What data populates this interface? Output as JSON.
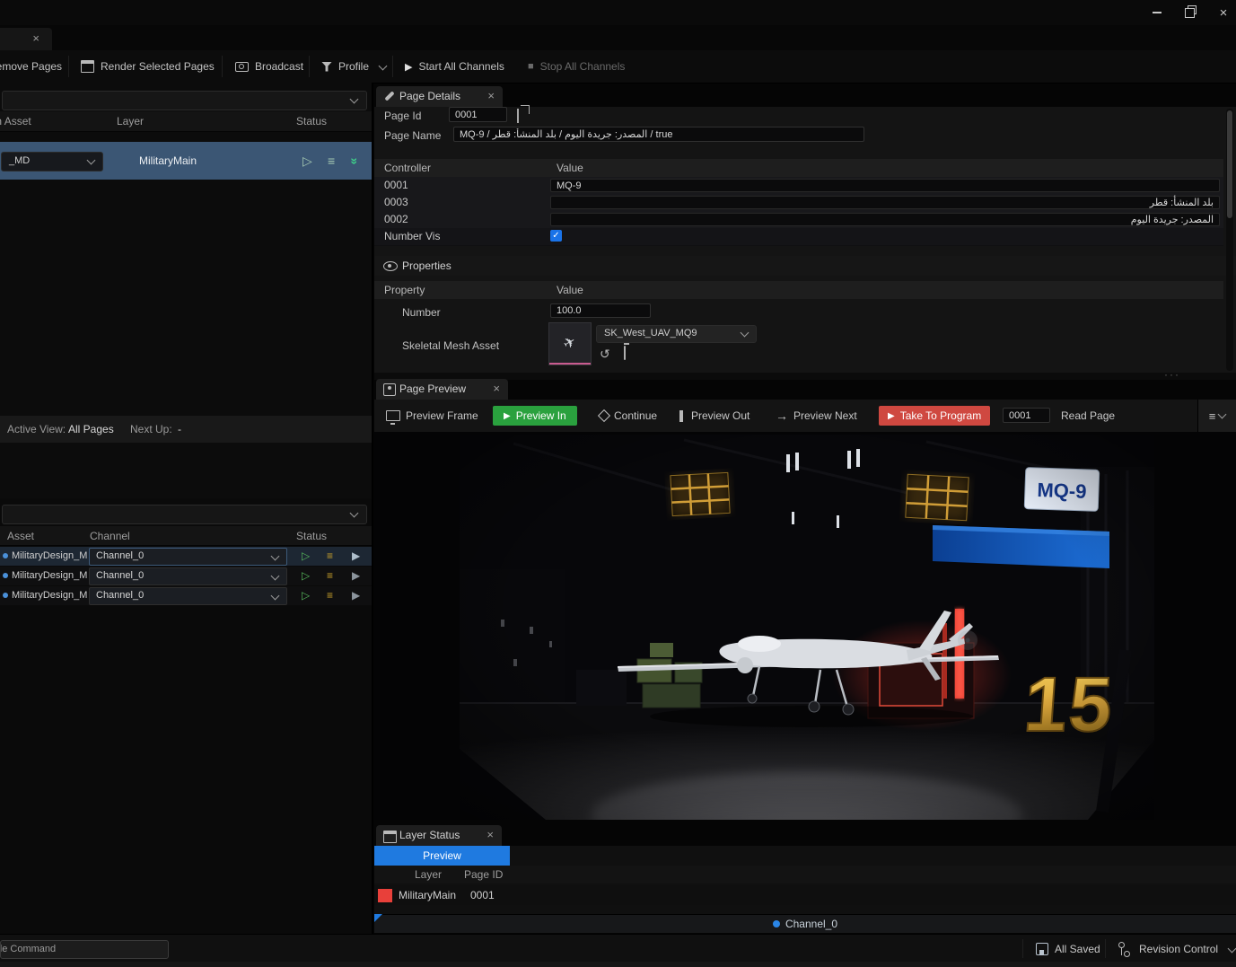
{
  "icons": {
    "close": "×",
    "play_filled": "▶",
    "play_outline": "▷",
    "menu": "≡",
    "double_chevron": "»",
    "stop": "■",
    "arrow_right": "→",
    "check": "✓",
    "dots": "···",
    "undo": "↺",
    "diamond": "◇",
    "plane": "✈"
  },
  "toolbar": {
    "remove_pages": "Remove Pages",
    "render_selected_pages": "Render Selected Pages",
    "broadcast": "Broadcast",
    "profile": "Profile",
    "start_all_channels": "Start All Channels",
    "stop_all_channels": "Stop All Channels"
  },
  "pages_panel": {
    "columns": {
      "asset": "Motion Asset",
      "layer": "Layer",
      "status": "Status"
    },
    "selected_row": {
      "asset_dropdown": "_MD",
      "layer": "MilitaryMain"
    },
    "active_view_label": "Active View:",
    "active_view_value": "All Pages",
    "next_up_label": "Next Up:",
    "next_up_value": "-"
  },
  "channels_panel": {
    "columns": {
      "asset": "Asset",
      "channel": "Channel",
      "status": "Status"
    },
    "rows": [
      {
        "asset": "MilitaryDesign_M",
        "channel": "Channel_0"
      },
      {
        "asset": "MilitaryDesign_M",
        "channel": "Channel_0"
      },
      {
        "asset": "MilitaryDesign_M",
        "channel": "Channel_0"
      }
    ]
  },
  "page_details": {
    "tab_title": "Page Details",
    "page_id_label": "Page Id",
    "page_id_value": "0001",
    "page_name_label": "Page Name",
    "page_name_value": "MQ-9 / المصدر: جريدة اليوم / بلد المنشأ: قطر / true",
    "controller_columns": {
      "controller": "Controller",
      "value": "Value"
    },
    "controller_rows": [
      {
        "name": "0001",
        "value": "MQ-9"
      },
      {
        "name": "0003",
        "value": "بلد المنشأ: قطر"
      },
      {
        "name": "0002",
        "value": "المصدر: جريدة اليوم"
      },
      {
        "name": "Number Vis",
        "value": "true"
      }
    ],
    "properties": {
      "title": "Properties",
      "columns": {
        "property": "Property",
        "value": "Value"
      },
      "number_label": "Number",
      "number_value": "100.0",
      "skeletal_mesh_label": "Skeletal Mesh Asset",
      "skeletal_mesh_value": "SK_West_UAV_MQ9"
    }
  },
  "page_preview": {
    "tab_title": "Page Preview",
    "toolbar": {
      "preview_frame": "Preview Frame",
      "preview_in": "Preview In",
      "continue_label": "Continue",
      "preview_out": "Preview Out",
      "preview_next": "Preview Next",
      "take_to_program": "Take To Program",
      "page_field": "0001",
      "read_page": "Read Page"
    },
    "scene": {
      "sign": "MQ-9",
      "number": "15"
    }
  },
  "layer_status": {
    "tab_title": "Layer Status",
    "preview_header": "Preview",
    "columns": {
      "layer": "Layer",
      "page_id": "Page ID"
    },
    "rows": [
      {
        "layer": "MilitaryMain",
        "page_id": "0001",
        "color": "#e8403a"
      }
    ]
  },
  "channel_bar": {
    "label": "Channel_0"
  },
  "status_bar": {
    "command": "Console Command",
    "all_saved": "All Saved",
    "revision_control": "Revision Control"
  },
  "colors": {
    "accent_blue": "#1f7ae0",
    "preview_green": "#2aa13e",
    "program_red": "#cf4840",
    "selected_row_blue": "#3b5674",
    "checkbox_blue": "#1a73e8",
    "status_yellow": "#c9a22b",
    "status_green": "#56b65c",
    "layer_swatch_red": "#e8403a",
    "gold": "#d9a43a"
  }
}
